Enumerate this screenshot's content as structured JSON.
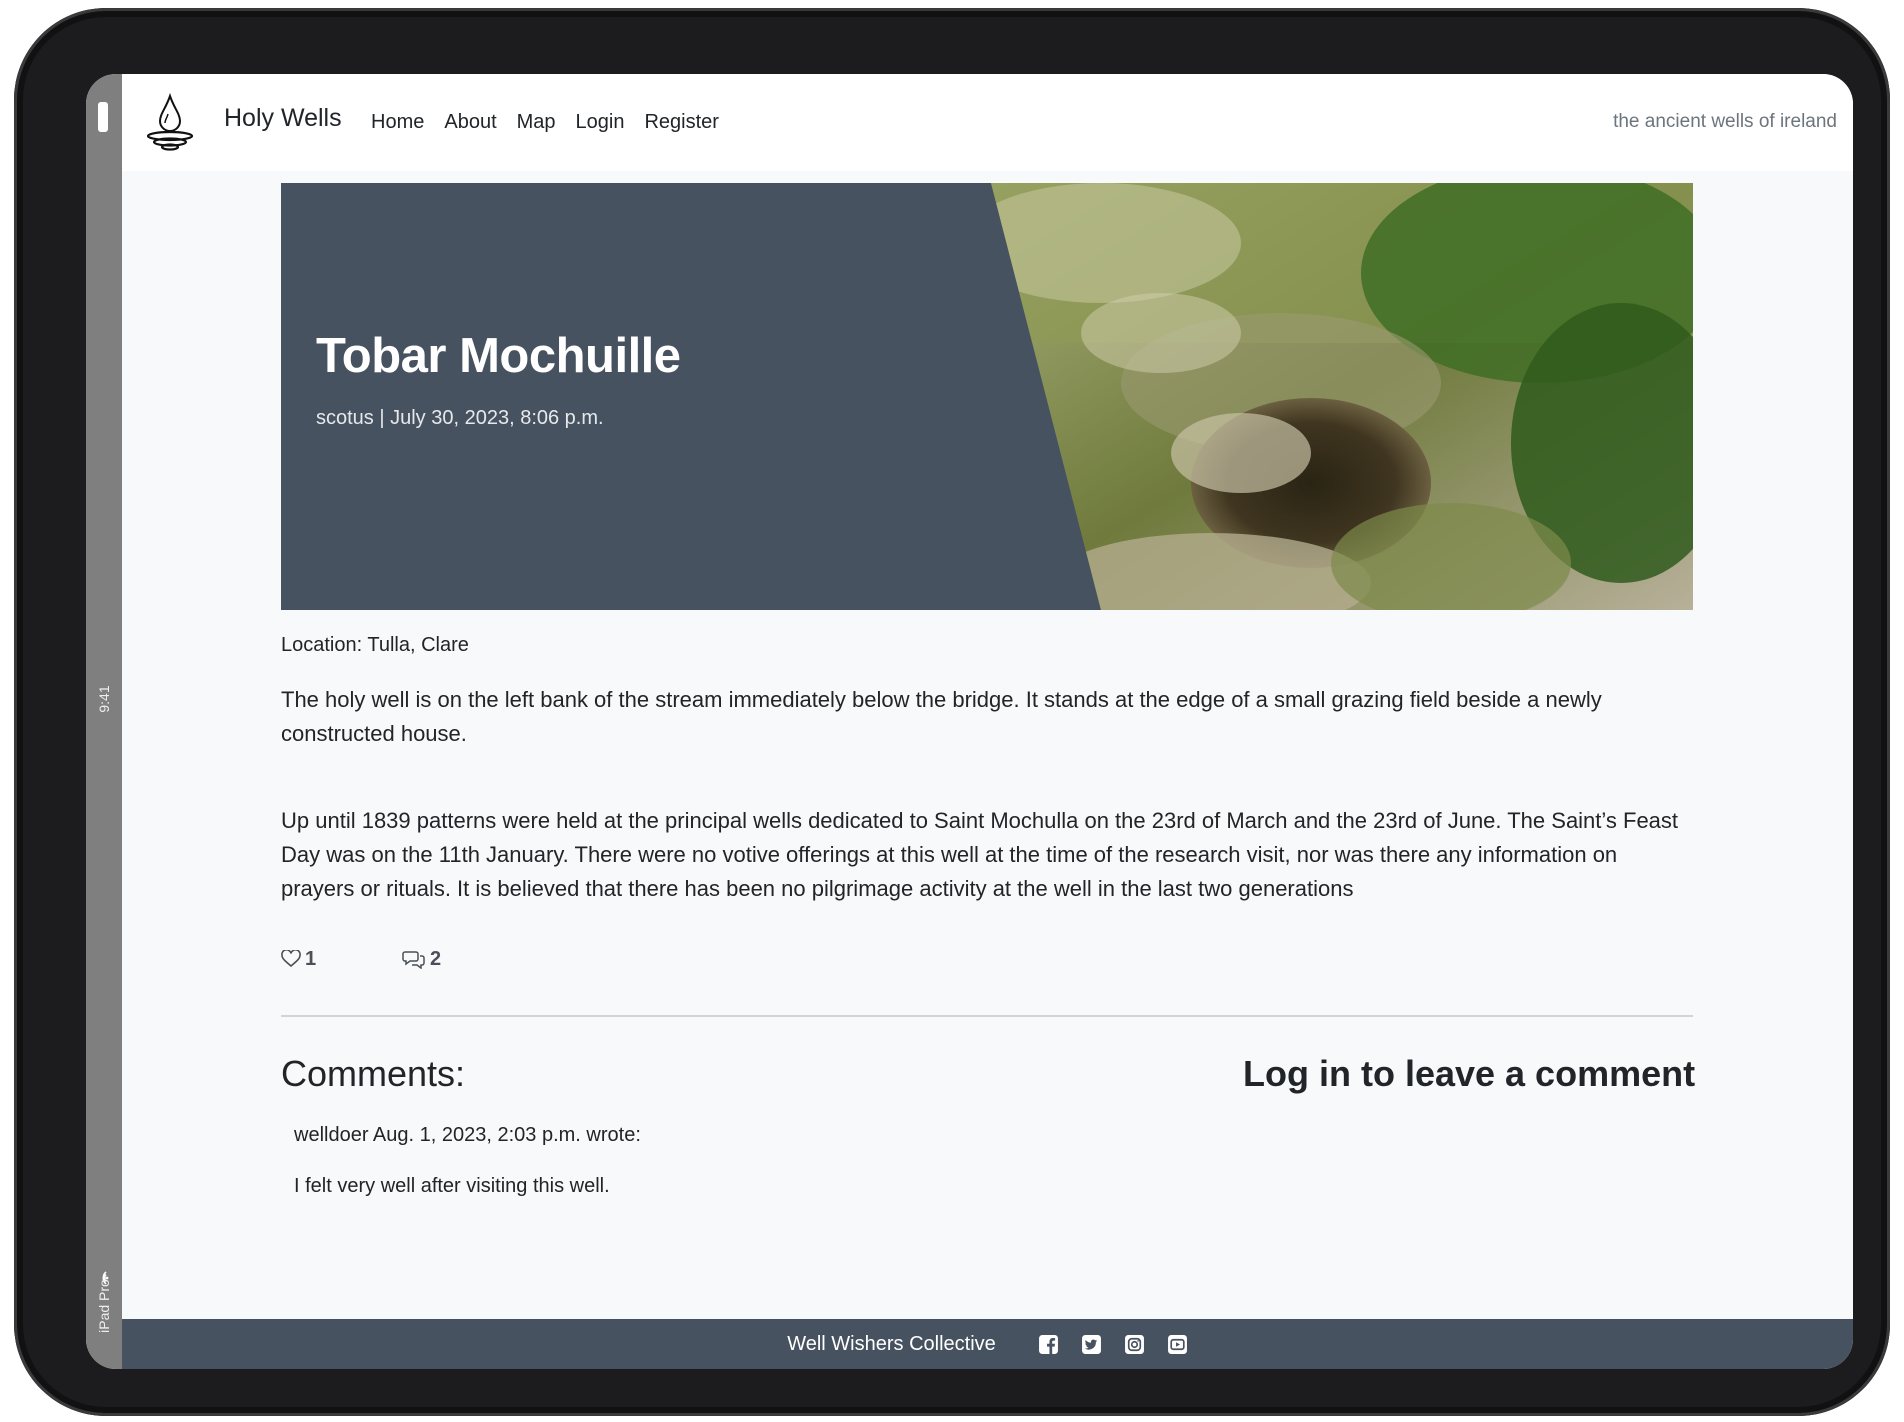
{
  "device": {
    "time": "9:41",
    "model": "iPad Pro"
  },
  "navbar": {
    "brand": "Holy Wells",
    "links": [
      "Home",
      "About",
      "Map",
      "Login",
      "Register"
    ],
    "tagline": "the ancient wells of ireland"
  },
  "post": {
    "title": "Tobar Mochuille",
    "meta": "scotus | July 30, 2023, 8:06 p.m.",
    "location": "Location: Tulla, Clare",
    "paragraphs": [
      "The holy well is on the left bank of the stream immediately below the bridge. It stands at the edge of a small grazing field beside a newly constructed house.",
      "Up until 1839 patterns were held at the principal wells dedicated to Saint Mochulla on the 23rd of March and the 23rd of June. The Saint’s Feast Day was on the 11th January. There were no votive offerings at this well at the time of the research visit, nor was there any information on prayers or rituals. It is believed that there has been no pilgrimage activity at the well in the last two generations"
    ],
    "likes": "1",
    "comment_count": "2"
  },
  "comments": {
    "heading": "Comments:",
    "login_prompt": "Log in to leave a comment",
    "items": [
      {
        "header": "welldoer Aug. 1, 2023, 2:03 p.m. wrote:",
        "body": "I felt very well after visiting this well."
      }
    ]
  },
  "footer": {
    "text": "Well Wishers Collective",
    "social": [
      "facebook-icon",
      "twitter-icon",
      "instagram-icon",
      "youtube-icon"
    ]
  },
  "colors": {
    "hero_bg": "#475260",
    "footer_bg": "#475260",
    "page_bg": "#f8f9fa"
  }
}
